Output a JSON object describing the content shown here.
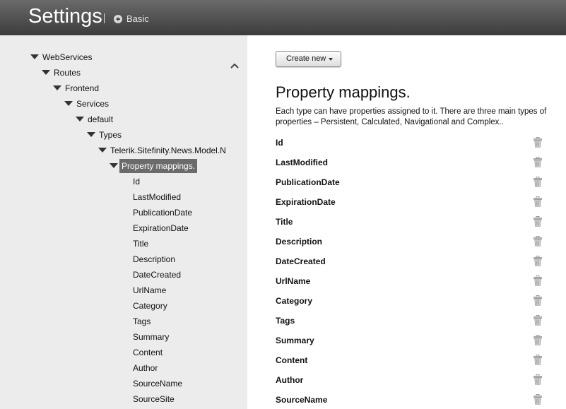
{
  "header": {
    "title": "Settings",
    "back_label": "Basic"
  },
  "sidebar": {
    "tree": [
      {
        "label": "WebServices",
        "expanded": true
      },
      {
        "label": "Routes",
        "expanded": true
      },
      {
        "label": "Frontend",
        "expanded": true
      },
      {
        "label": "Services",
        "expanded": true
      },
      {
        "label": "default",
        "expanded": true
      },
      {
        "label": "Types",
        "expanded": true
      },
      {
        "label": "Telerik.Sitefinity.News.Model.N",
        "expanded": true
      },
      {
        "label": "Property mappings.",
        "expanded": true,
        "selected": true
      }
    ],
    "leaves": [
      "Id",
      "LastModified",
      "PublicationDate",
      "ExpirationDate",
      "Title",
      "Description",
      "DateCreated",
      "UrlName",
      "Category",
      "Tags",
      "Summary",
      "Content",
      "Author",
      "SourceName",
      "SourceSite"
    ]
  },
  "main": {
    "create_button": "Create new",
    "title": "Property mappings.",
    "description": "Each type can have properties assigned to it. There are three main types of properties – Persistent, Calculated, Navigational and Complex..",
    "properties": [
      "Id",
      "LastModified",
      "PublicationDate",
      "ExpirationDate",
      "Title",
      "Description",
      "DateCreated",
      "UrlName",
      "Category",
      "Tags",
      "Summary",
      "Content",
      "Author",
      "SourceName"
    ]
  },
  "colors": {
    "header_bg": "#4f4f4f",
    "sidebar_bg": "#ececec",
    "selected_bg": "#6b6b6b"
  },
  "icons": {
    "back": "arrow-left-circle-icon",
    "collapse": "chevron-up-icon",
    "delete": "trash-icon",
    "tree_toggle": "triangle-down-icon"
  }
}
